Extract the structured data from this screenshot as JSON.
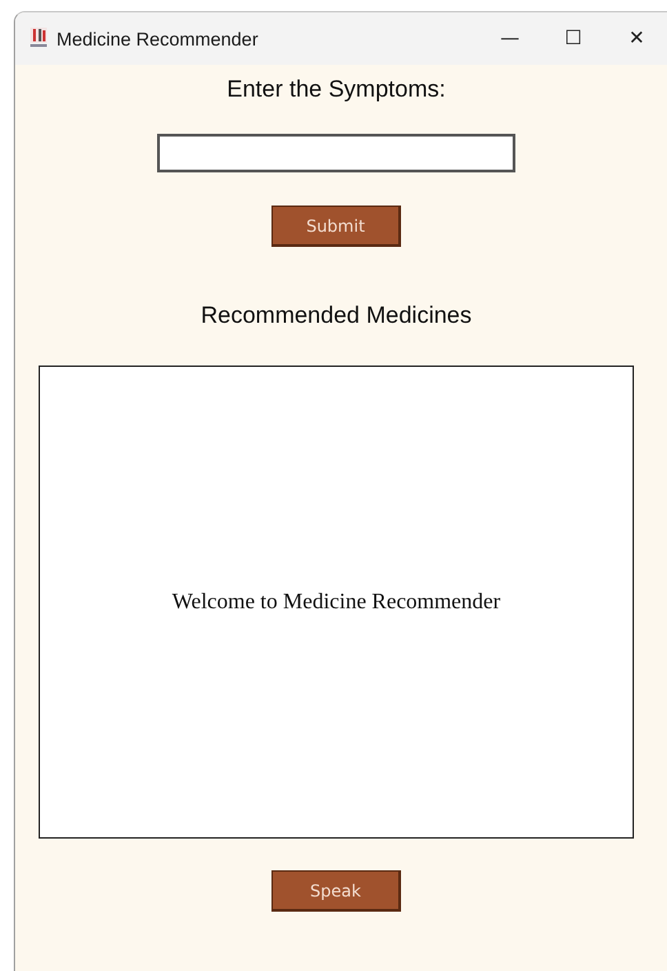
{
  "window": {
    "title": "Medicine Recommender",
    "controls": [
      "—",
      "☐",
      "✕"
    ]
  },
  "symptoms": {
    "label": "Enter the Symptoms:"
  },
  "submit_button": "Submit",
  "results": {
    "heading": "Recommended Medicines",
    "message": "Welcome to Medicine Recommender"
  },
  "speak_button": "Speak"
}
